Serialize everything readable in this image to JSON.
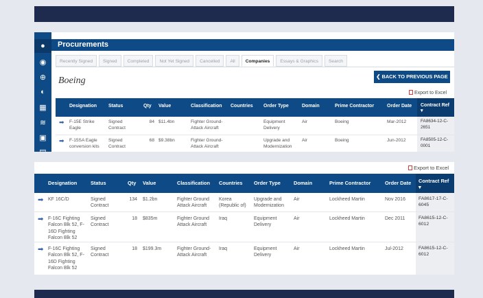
{
  "top_panel": {
    "header": "Procurements",
    "tabs": [
      {
        "label": "Recently Signed",
        "active": false
      },
      {
        "label": "Signed",
        "active": false
      },
      {
        "label": "Completed",
        "active": false
      },
      {
        "label": "Not Yet Signed",
        "active": false
      },
      {
        "label": "Cancelled",
        "active": false
      },
      {
        "label": "All",
        "active": false
      },
      {
        "label": "Companies",
        "active": true
      },
      {
        "label": "Essays & Graphics",
        "active": false
      },
      {
        "label": "Search",
        "active": false
      }
    ],
    "company": "Boeing",
    "back_button": "BACK TO PREVIOUS PAGE",
    "export_label": "Export to Excel",
    "columns": [
      "Designation",
      "Status",
      "Qty",
      "Value",
      "Classification",
      "Countries",
      "Order Type",
      "Domain",
      "Prime Contractor",
      "Order Date",
      "Contract Ref"
    ],
    "rows": [
      {
        "designation": "F-15E Strike Eagle",
        "status": "Signed Contract",
        "qty": "84",
        "value": "$11.4bn",
        "classification": "Fighter Ground-Attack Aircraft",
        "countries": "",
        "order_type": "Equipment Delivery",
        "domain": "Air",
        "prime": "Boeing",
        "date": "Mar-2012",
        "ref": "FA8634-12-C-2651"
      },
      {
        "designation": "F-15SA Eagle conversion kits",
        "status": "Signed Contract",
        "qty": "68",
        "value": "$9.38bn",
        "classification": "Fighter Ground-Attack Aircraft",
        "countries": "",
        "order_type": "Upgrade and Modernization",
        "domain": "Air",
        "prime": "Boeing",
        "date": "Jun-2012",
        "ref": "FA8505-12-C-0001"
      }
    ]
  },
  "bottom_panel": {
    "export_label": "Export to Excel",
    "columns": [
      "Designation",
      "Status",
      "Qty",
      "Value",
      "Classification",
      "Countries",
      "Order Type",
      "Domain",
      "Prime Contractor",
      "Order Date",
      "Contract Ref"
    ],
    "rows": [
      {
        "designation": "KF 16C/D",
        "status": "Signed Contract",
        "qty": "134",
        "value": "$1.2bn",
        "classification": "Fighter Ground Attack Aircraft",
        "countries": "Korea (Republic of)",
        "order_type": "Upgrade and Modernization",
        "domain": "Air",
        "prime": "Lockheed Martin",
        "date": "Nov 2016",
        "ref": "FA8617-17-C-6045"
      },
      {
        "designation": "F-16C Fighting Falcon Blk 52, F-16D Fighting Falcon Blk 52",
        "status": "Signed Contract",
        "qty": "18",
        "value": "$835m",
        "classification": "Fighter Ground Attack Aircraft",
        "countries": "Iraq",
        "order_type": "Equipment Delivery",
        "domain": "Air",
        "prime": "Lockheed Martin",
        "date": "Dec 2011",
        "ref": "FA8615-12-C-6012"
      },
      {
        "designation": "F-16C Fighting Falcon Blk 52, F-16D Fighting Falcon Blk 52",
        "status": "Signed Contract",
        "qty": "18",
        "value": "$199.3m",
        "classification": "Fighter Ground-Attack Aircraft",
        "countries": "Iraq",
        "order_type": "Equipment Delivery",
        "domain": "Air",
        "prime": "Lockheed Martin",
        "date": "Jul-2012",
        "ref": "FA8615-12-C-6012"
      }
    ]
  },
  "sidebar_icons": [
    "home-icon",
    "globe-icon",
    "crosshair-icon",
    "gauge-icon",
    "factory-icon",
    "radar-icon",
    "calculator-icon",
    "folder-icon"
  ],
  "colors": {
    "primary": "#0e4a86",
    "dark_bar": "#1e2a4e",
    "background": "#e6e8ef",
    "excel_icon": "#d43b3b"
  }
}
